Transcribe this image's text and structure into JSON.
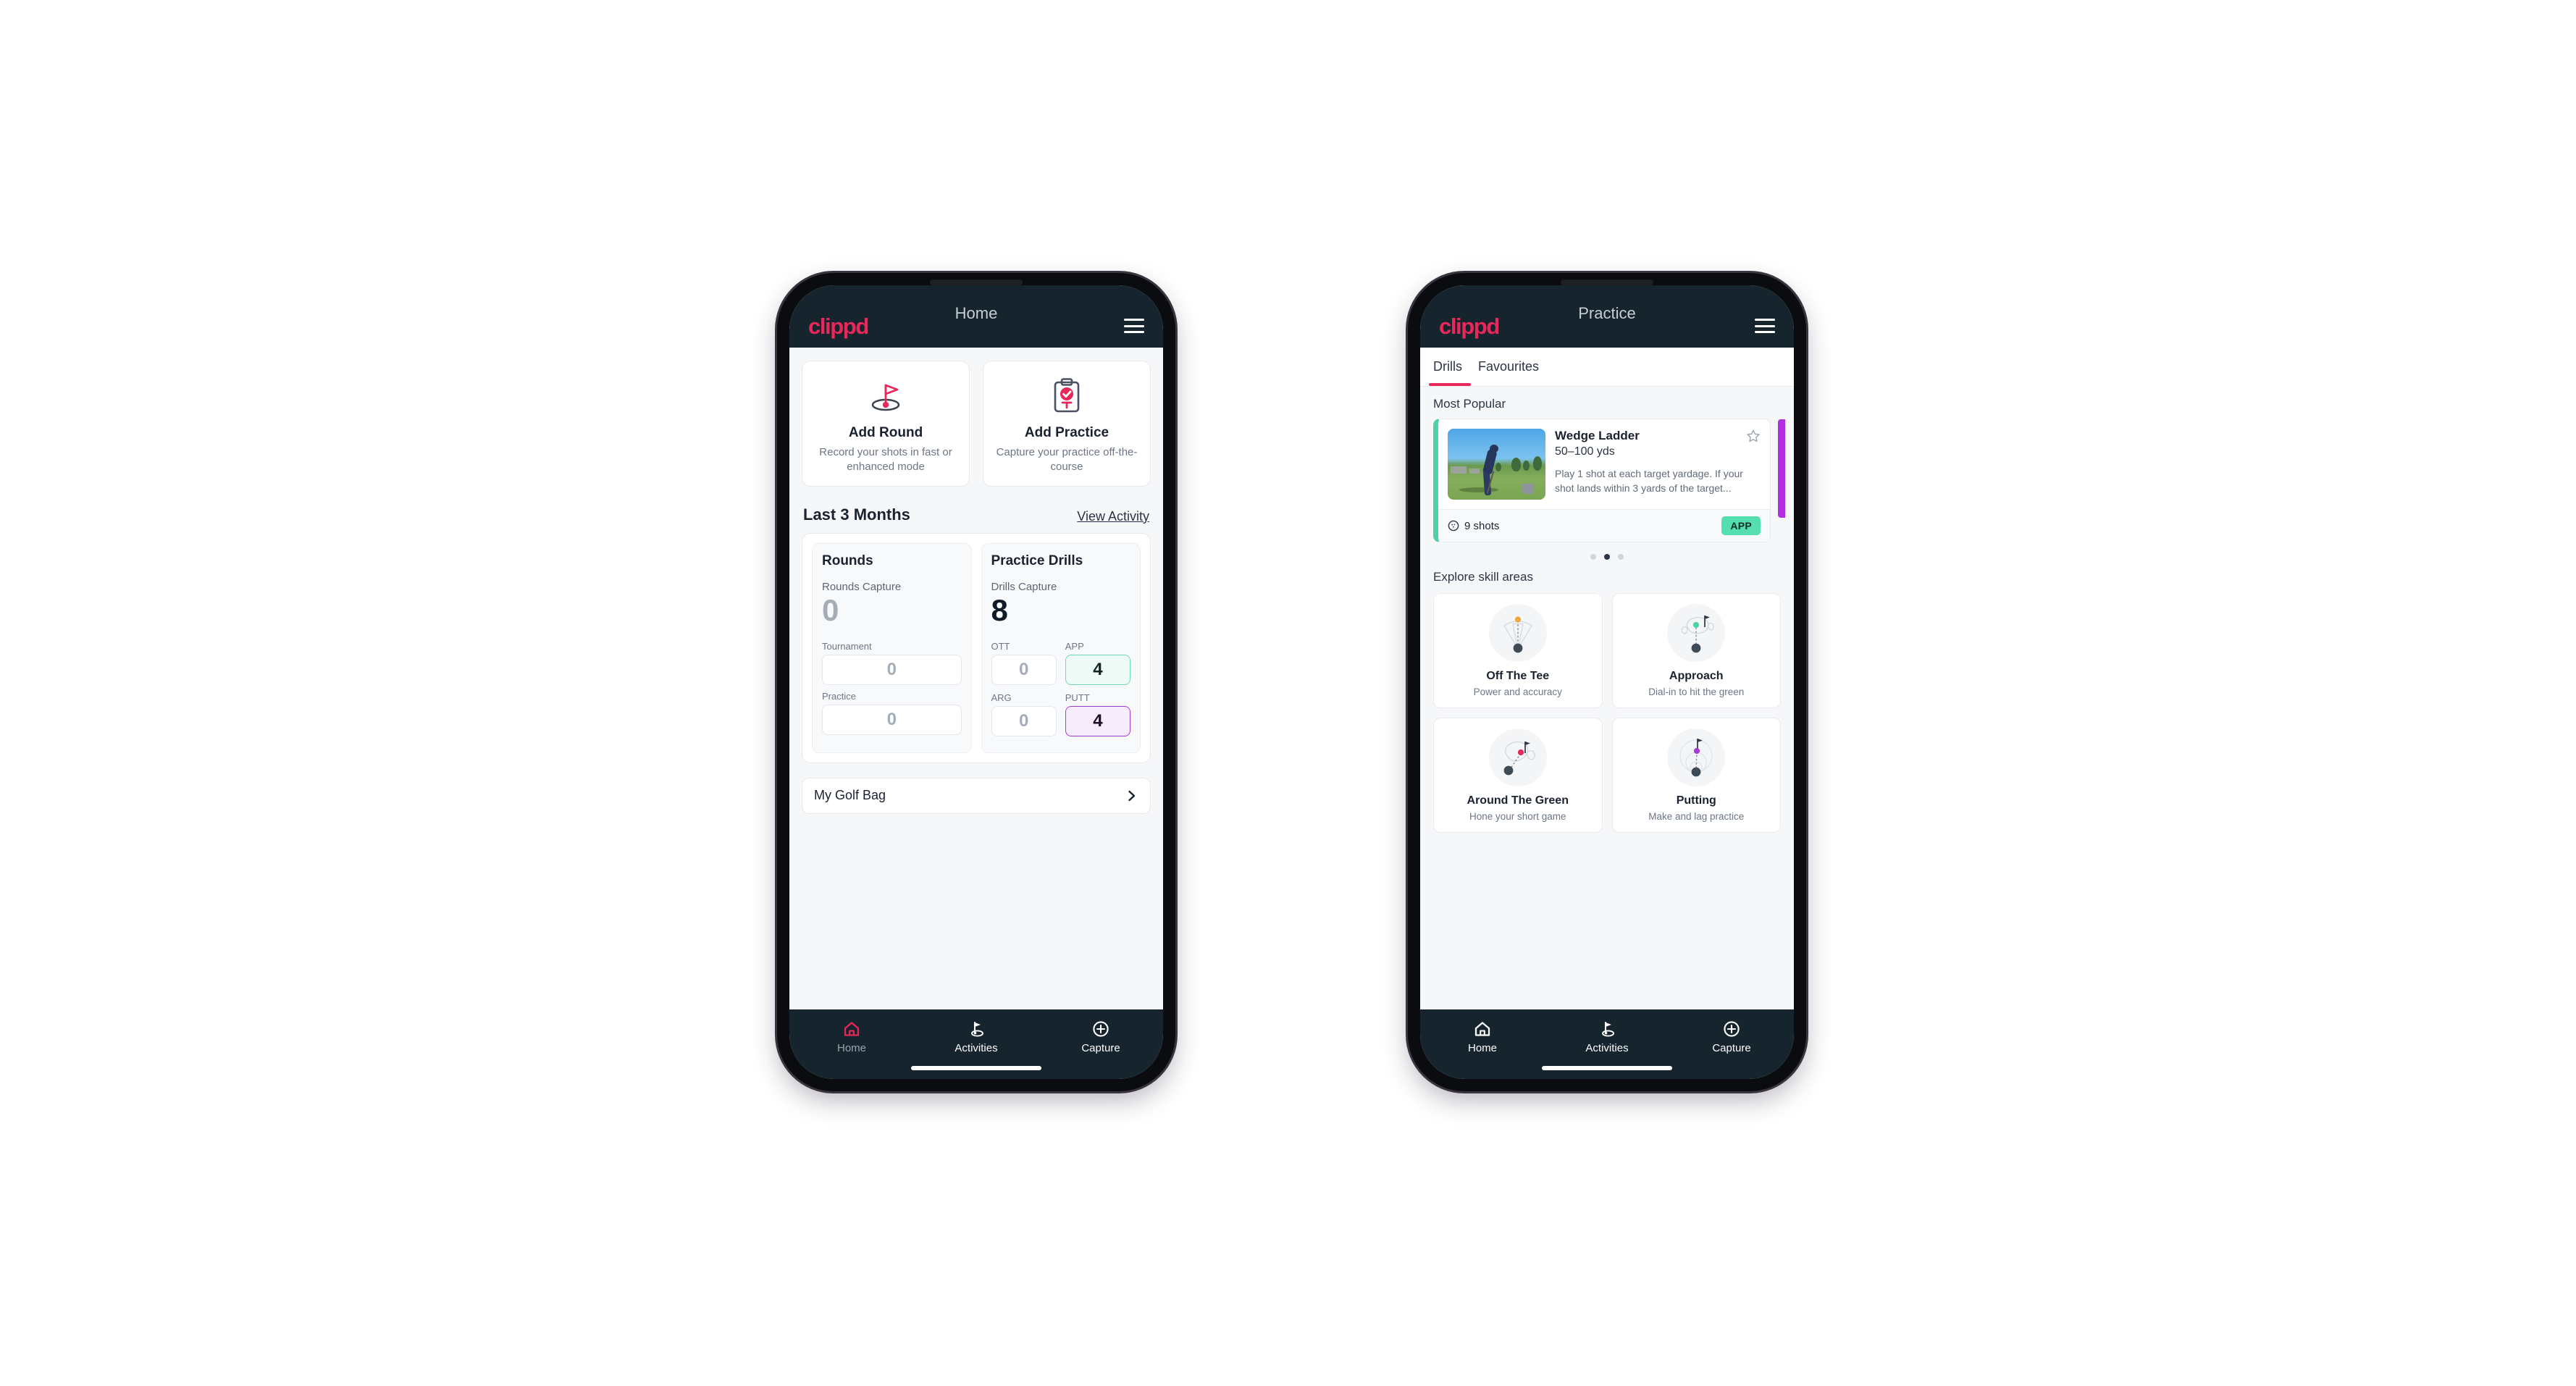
{
  "brand": {
    "name": "clippd",
    "accent": "#e8275a",
    "dark": "#16242e"
  },
  "phone_left": {
    "appbar": {
      "logo": "clippd",
      "title": "Home",
      "menu_icon": "hamburger-icon"
    },
    "quick_actions": [
      {
        "icon": "golf-flag-hole-icon",
        "title": "Add Round",
        "subtitle": "Record your shots in fast or enhanced mode"
      },
      {
        "icon": "clipboard-check-tee-icon",
        "title": "Add Practice",
        "subtitle": "Capture your practice off-the-course"
      }
    ],
    "section": {
      "title": "Last 3 Months",
      "link": "View Activity"
    },
    "rounds": {
      "heading": "Rounds",
      "capture_label": "Rounds Capture",
      "capture_value": "0",
      "rows": [
        {
          "label": "Tournament",
          "value": "0"
        },
        {
          "label": "Practice",
          "value": "0"
        }
      ]
    },
    "practice_drills": {
      "heading": "Practice Drills",
      "capture_label": "Drills Capture",
      "capture_value": "8",
      "cells": [
        {
          "label": "OTT",
          "value": "0",
          "style": "plain"
        },
        {
          "label": "APP",
          "value": "4",
          "style": "app"
        },
        {
          "label": "ARG",
          "value": "0",
          "style": "plain"
        },
        {
          "label": "PUTT",
          "value": "4",
          "style": "putt"
        }
      ]
    },
    "golf_bag": {
      "label": "My Golf Bag",
      "icon": "chevron-right-icon"
    },
    "nav": [
      {
        "icon": "home-icon",
        "label": "Home",
        "active": true
      },
      {
        "icon": "golf-flag-icon",
        "label": "Activities",
        "active": false
      },
      {
        "icon": "plus-circle-icon",
        "label": "Capture",
        "active": false
      }
    ]
  },
  "phone_right": {
    "appbar": {
      "logo": "clippd",
      "title": "Practice",
      "menu_icon": "hamburger-icon"
    },
    "tabs": [
      {
        "label": "Drills",
        "active": true
      },
      {
        "label": "Favourites",
        "active": false
      }
    ],
    "most_popular_label": "Most Popular",
    "drill_card": {
      "accent": "#4fd1a5",
      "name": "Wedge Ladder",
      "yardage": "50–100 yds",
      "description": "Play 1 shot at each target yardage. If your shot lands within 3 yards of the target...",
      "shots": "9 shots",
      "shots_icon": "golf-ball-icon",
      "badge": "APP",
      "badge_color": "#55dfb0",
      "favourite_icon": "star-outline-icon",
      "thumbnail": "golfer-wedge-shot-photo"
    },
    "carousel_dots": {
      "count": 3,
      "active_index": 1
    },
    "peek_card_accent": "#b22ee0",
    "skills_label": "Explore skill areas",
    "skills": [
      {
        "icon": "tee-dispersion-fan-icon",
        "dot": "#f2a93b",
        "name": "Off The Tee",
        "subtitle": "Power and accuracy"
      },
      {
        "icon": "green-approach-icon",
        "dot": "#4fd1a5",
        "name": "Approach",
        "subtitle": "Dial-in to hit the green"
      },
      {
        "icon": "chip-around-green-icon",
        "dot": "#e8275a",
        "name": "Around The Green",
        "subtitle": "Hone your short game"
      },
      {
        "icon": "putting-rings-icon",
        "dot": "#a63bd6",
        "name": "Putting",
        "subtitle": "Make and lag practice"
      }
    ],
    "nav": [
      {
        "icon": "home-icon",
        "label": "Home",
        "active": false
      },
      {
        "icon": "golf-flag-icon",
        "label": "Activities",
        "active": true
      },
      {
        "icon": "plus-circle-icon",
        "label": "Capture",
        "active": false
      }
    ]
  }
}
